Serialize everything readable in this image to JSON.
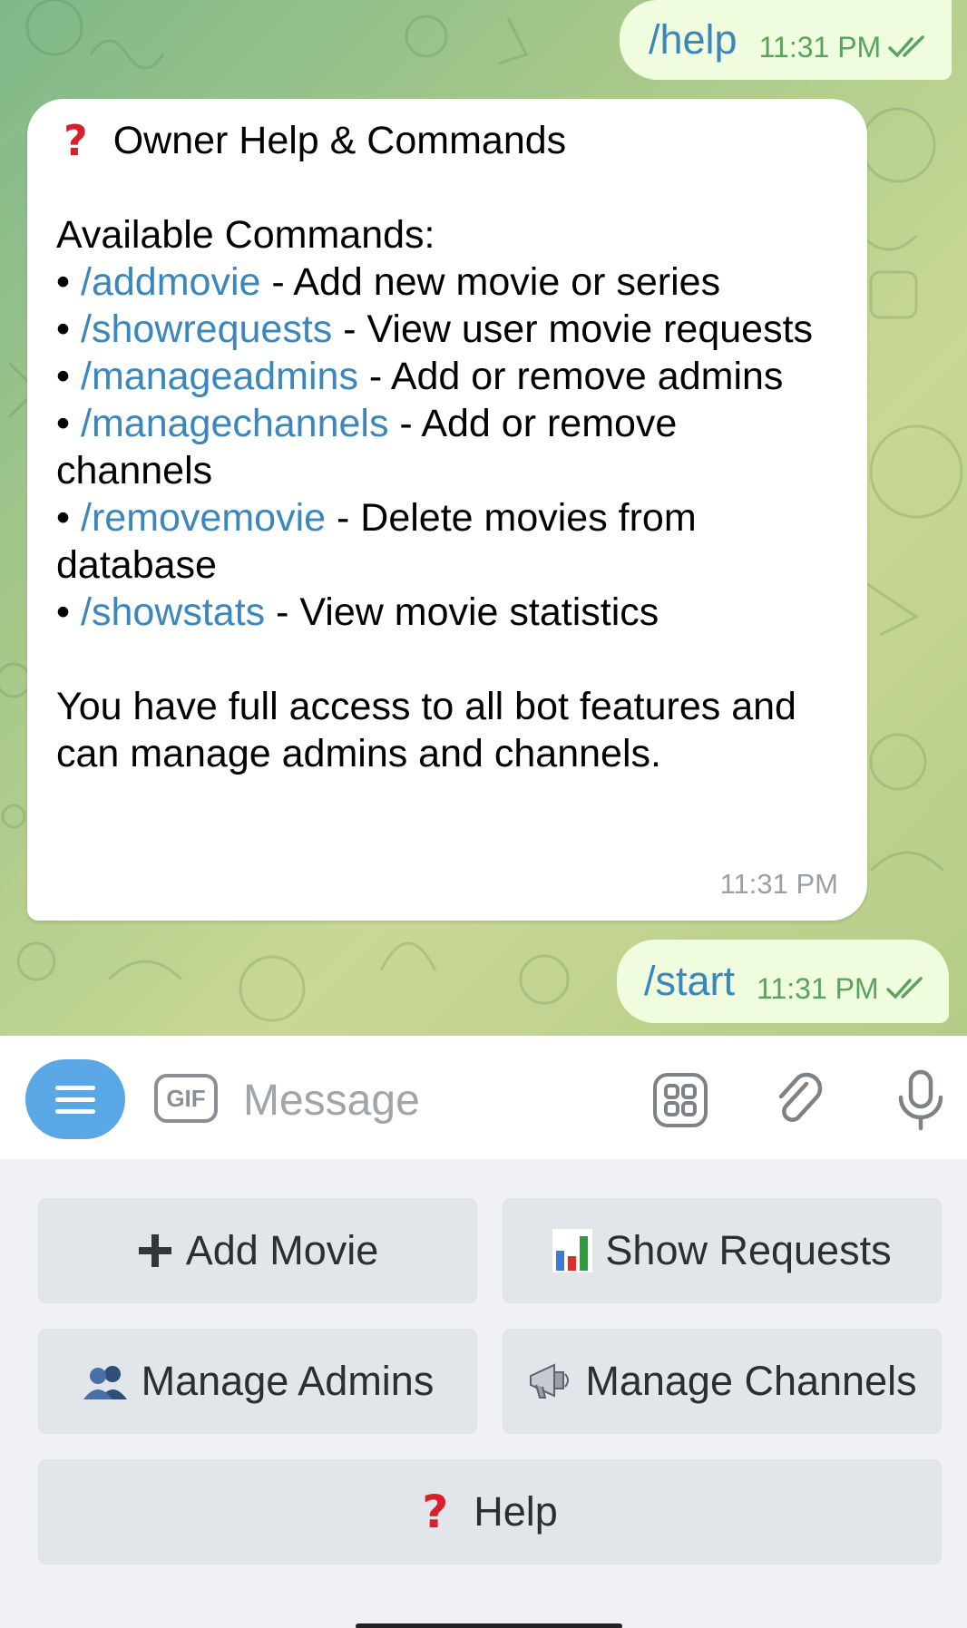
{
  "chat": {
    "messages": [
      {
        "text": "/help",
        "time": "11:31 PM"
      },
      {
        "title": "Owner Help & Commands",
        "heading": "Available Commands:",
        "commands": [
          {
            "cmd": "/addmovie",
            "desc": "Add new movie or series"
          },
          {
            "cmd": "/showrequests",
            "desc": "View user movie requests"
          },
          {
            "cmd": "/manageadmins",
            "desc": "Add or remove admins"
          },
          {
            "cmd": "/managechannels",
            "desc": "Add or remove channels"
          },
          {
            "cmd": "/removemovie",
            "desc": "Delete movies from database"
          },
          {
            "cmd": "/showstats",
            "desc": "View movie statistics"
          }
        ],
        "footer": "You have full access to all bot features and can manage admins and channels.",
        "time": "11:31 PM"
      },
      {
        "text": "/start",
        "time": "11:31 PM"
      }
    ]
  },
  "input": {
    "placeholder": "Message",
    "gif_label": "GIF",
    "icons": [
      "menu-icon",
      "gif-icon",
      "sticker-icon",
      "paperclip-icon",
      "microphone-icon"
    ]
  },
  "keyboard": {
    "buttons": [
      {
        "label": "Add Movie",
        "icon": "plus-icon"
      },
      {
        "label": "Show Requests",
        "icon": "bar-chart-icon"
      },
      {
        "label": "Manage Admins",
        "icon": "users-icon"
      },
      {
        "label": "Manage Channels",
        "icon": "megaphone-icon"
      },
      {
        "label": "Help",
        "icon": "question-icon"
      }
    ]
  },
  "colors": {
    "link": "#3a86bd",
    "outgoing_bubble": "#effdde",
    "menu_button": "#5aa7e5",
    "question_mark": "#d9202a"
  }
}
